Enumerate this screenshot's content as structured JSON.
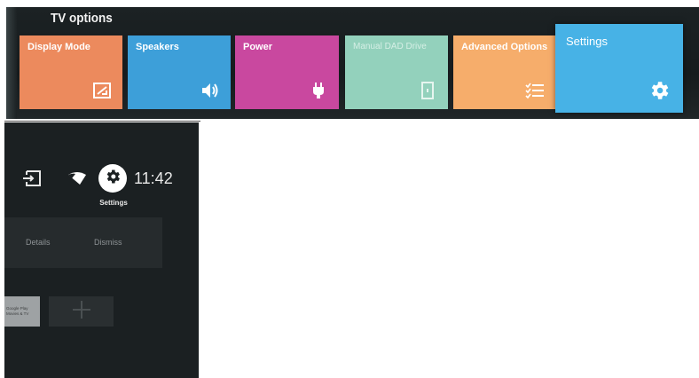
{
  "tv_options": {
    "title": "TV options",
    "tiles": [
      {
        "label": "Display Mode",
        "icon": "picture-frame-icon",
        "color": "#ec8a5d"
      },
      {
        "label": "Speakers",
        "icon": "speaker-icon",
        "color": "#3d9fd9"
      },
      {
        "label": "Power",
        "icon": "plug-icon",
        "color": "#c9489f"
      },
      {
        "label": "Manual DAD Drive",
        "icon": "panel-icon",
        "color": "#93d1bc"
      },
      {
        "label": "Advanced Options",
        "icon": "list-settings-icon",
        "color": "#f6ad6b"
      },
      {
        "label": "Settings",
        "icon": "gear-icon",
        "color": "#47b2e6",
        "selected": true
      }
    ]
  },
  "home": {
    "status": {
      "input_icon": "input-source-icon",
      "network_icon": "wifi-icon",
      "settings_icon": "gear-icon",
      "settings_caption": "Settings",
      "clock": "11:42"
    },
    "notification": {
      "details_label": "Details",
      "dismiss_label": "Dismiss"
    },
    "apps": {
      "tile_label_line1": "Google Play",
      "tile_label_line2": "Movies & TV",
      "add_icon": "plus-icon"
    }
  }
}
